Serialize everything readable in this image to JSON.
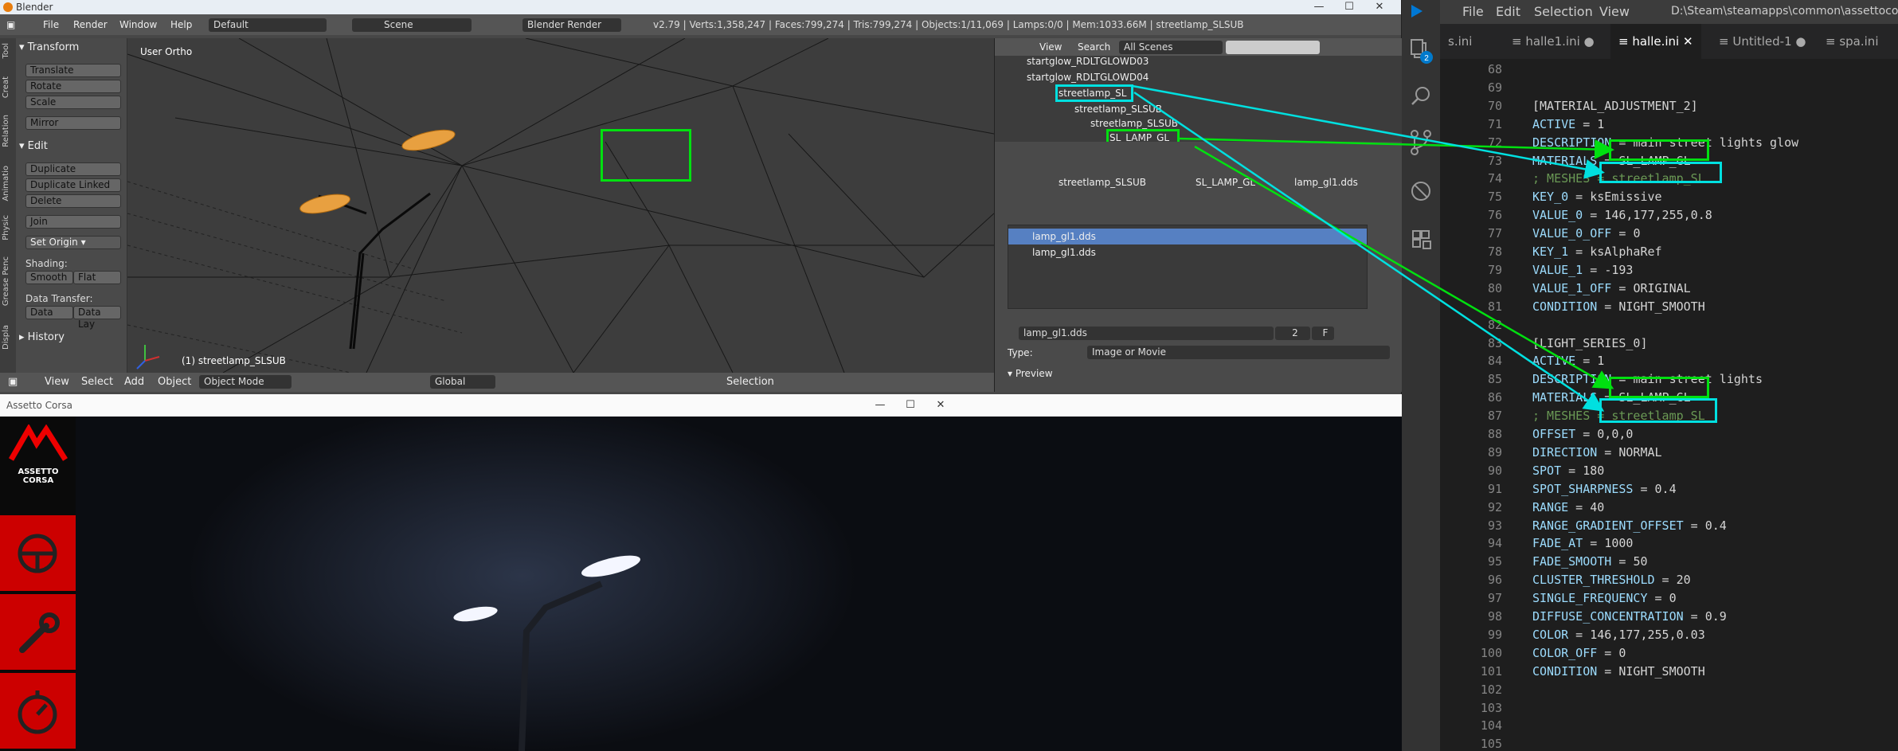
{
  "blender": {
    "title": "Blender",
    "menu": [
      "File",
      "Render",
      "Window",
      "Help"
    ],
    "layout": "Default",
    "scene": "Scene",
    "engine": "Blender Render",
    "info": "v2.79 | Verts:1,358,247 | Faces:799,274 | Tris:799,274 | Objects:1/11,069 | Lamps:0/0 | Mem:1033.66M | streetlamp_SLSUB",
    "toolshelf": {
      "tabs": [
        "Tool",
        "Creat",
        "Relation",
        "Animatio",
        "Physic",
        "Grease Penc",
        "Displa"
      ],
      "transform_header": "Transform",
      "transform_buttons": [
        "Translate",
        "Rotate",
        "Scale",
        "Mirror"
      ],
      "edit_header": "Edit",
      "edit_buttons": [
        "Duplicate",
        "Duplicate Linked",
        "Delete",
        "Join"
      ],
      "set_origin": "Set Origin",
      "shading_label": "Shading:",
      "smooth": "Smooth",
      "flat": "Flat",
      "data_transfer_label": "Data Transfer:",
      "data": "Data",
      "data_lay": "Data Lay",
      "history": "History"
    },
    "viewport": {
      "label": "User Ortho",
      "object": "(1) streetlamp_SLSUB"
    },
    "bottom": {
      "view": "View",
      "select": "Select",
      "add": "Add",
      "object": "Object",
      "mode": "Object Mode",
      "orientation": "Global",
      "selection": "Selection"
    },
    "outliner": {
      "view": "View",
      "search": "Search",
      "filter": "All Scenes",
      "rows": [
        "startglow_RDLTGLOWD03",
        "startglow_RDLTGLOWD04",
        "streetlamp_SL",
        "streetlamp_SLSUB",
        "streetlamp_SLSUB",
        "SL_LAMP_GL"
      ]
    },
    "props": {
      "breadcrumb": [
        "streetlamp_SLSUB",
        "SL_LAMP_GL",
        "lamp_gl1.dds"
      ],
      "textures": [
        "lamp_gl1.dds",
        "lamp_gl1.dds"
      ],
      "tex_name": "lamp_gl1.dds",
      "users": "2",
      "fake": "F",
      "type_label": "Type:",
      "type_value": "Image or Movie",
      "preview": "Preview"
    }
  },
  "assetto": {
    "title": "Assetto Corsa",
    "logo_text": "ASSETTO CORSA"
  },
  "vscode": {
    "menu": [
      "File",
      "Edit",
      "Selection",
      "View"
    ],
    "path": "D:\\Steam\\steamapps\\common\\assettocorsa\\exten...",
    "badge": "2",
    "tabs": [
      {
        "label": "s.ini",
        "state": ""
      },
      {
        "label": "halle1.ini",
        "state": "●"
      },
      {
        "label": "halle.ini",
        "state": "✕"
      },
      {
        "label": "Untitled-1",
        "state": "●"
      },
      {
        "label": "spa.ini",
        "state": ""
      }
    ],
    "lines": [
      {
        "n": "68",
        "key": "",
        "val": ""
      },
      {
        "n": "69",
        "key": "",
        "val": ""
      },
      {
        "n": "70",
        "key": "",
        "val": "[MATERIAL_ADJUSTMENT_2]"
      },
      {
        "n": "71",
        "key": "ACTIVE",
        "val": "1"
      },
      {
        "n": "72",
        "key": "DESCRIPTION",
        "val": "main street lights glow"
      },
      {
        "n": "73",
        "key": "MATERIALS",
        "val": "SL_LAMP_GL"
      },
      {
        "n": "74",
        "key": "; MESHES",
        "val": "streetlamp_SL"
      },
      {
        "n": "75",
        "key": "KEY_0",
        "val": "ksEmissive"
      },
      {
        "n": "76",
        "key": "VALUE_0",
        "val": "146,177,255,0.8"
      },
      {
        "n": "77",
        "key": "VALUE_0_OFF",
        "val": "0"
      },
      {
        "n": "78",
        "key": "KEY_1",
        "val": "ksAlphaRef"
      },
      {
        "n": "79",
        "key": "VALUE_1",
        "val": "-193"
      },
      {
        "n": "80",
        "key": "VALUE_1_OFF",
        "val": "ORIGINAL"
      },
      {
        "n": "81",
        "key": "CONDITION",
        "val": "NIGHT_SMOOTH"
      },
      {
        "n": "82",
        "key": "",
        "val": ""
      },
      {
        "n": "83",
        "key": "",
        "val": "[LIGHT_SERIES_0]"
      },
      {
        "n": "84",
        "key": "ACTIVE",
        "val": "1"
      },
      {
        "n": "85",
        "key": "DESCRIPTION",
        "val": "main street lights"
      },
      {
        "n": "86",
        "key": "MATERIALS",
        "val": "SL_LAMP_GL"
      },
      {
        "n": "87",
        "key": "; MESHES",
        "val": "streetlamp_SL"
      },
      {
        "n": "88",
        "key": "OFFSET",
        "val": "0,0,0"
      },
      {
        "n": "89",
        "key": "DIRECTION",
        "val": "NORMAL"
      },
      {
        "n": "90",
        "key": "SPOT",
        "val": "180"
      },
      {
        "n": "91",
        "key": "SPOT_SHARPNESS",
        "val": "0.4"
      },
      {
        "n": "92",
        "key": "RANGE",
        "val": "40"
      },
      {
        "n": "93",
        "key": "RANGE_GRADIENT_OFFSET",
        "val": "0.4"
      },
      {
        "n": "94",
        "key": "FADE_AT",
        "val": "1000"
      },
      {
        "n": "95",
        "key": "FADE_SMOOTH",
        "val": "50"
      },
      {
        "n": "96",
        "key": "CLUSTER_THRESHOLD",
        "val": "20"
      },
      {
        "n": "97",
        "key": "SINGLE_FREQUENCY",
        "val": "0"
      },
      {
        "n": "98",
        "key": "DIFFUSE_CONCENTRATION",
        "val": "0.9"
      },
      {
        "n": "99",
        "key": "COLOR",
        "val": "146,177,255,0.03"
      },
      {
        "n": "100",
        "key": "COLOR_OFF",
        "val": "0"
      },
      {
        "n": "101",
        "key": "CONDITION",
        "val": "NIGHT_SMOOTH"
      },
      {
        "n": "102",
        "key": "",
        "val": ""
      },
      {
        "n": "103",
        "key": "",
        "val": ""
      },
      {
        "n": "104",
        "key": "",
        "val": ""
      },
      {
        "n": "105",
        "key": "",
        "val": ""
      }
    ]
  },
  "colors": {
    "annotation_green": "#00e010",
    "annotation_cyan": "#00e0e0",
    "blender_orange": "#e87d0d",
    "ac_red": "#cc0000"
  },
  "icons": [
    "explorer-icon",
    "search-icon",
    "source-control-icon",
    "debug-icon",
    "extensions-icon",
    "steering-wheel-icon",
    "wrench-icon",
    "stopwatch-icon"
  ]
}
